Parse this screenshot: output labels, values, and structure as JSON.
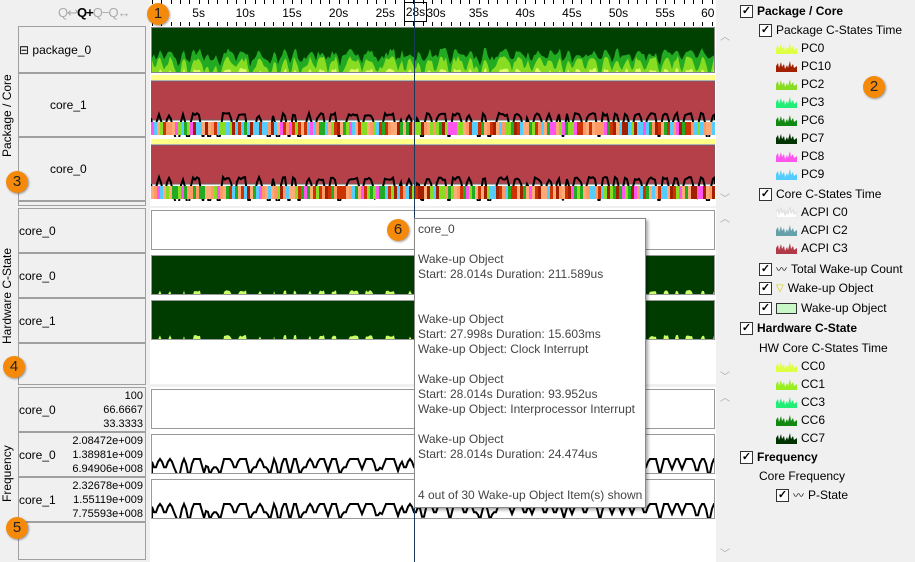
{
  "toolbar": {
    "zoom_icons": [
      "zoom-undo",
      "zoom-in",
      "zoom-out",
      "zoom-fit"
    ]
  },
  "ruler": {
    "labels": [
      "5s",
      "10s",
      "15s",
      "20s",
      "25s",
      "30s",
      "35s",
      "40s",
      "45s",
      "50s",
      "55s",
      "60"
    ],
    "current": "28s"
  },
  "sections": {
    "package_core": {
      "title": "Package / Core",
      "rows": [
        "package_0",
        "core_1",
        "core_0"
      ],
      "expand_symbol": "⊟"
    },
    "hardware": {
      "title": "Hardware C-State",
      "rows": [
        "core_0",
        "core_0",
        "core_1"
      ]
    },
    "frequency": {
      "title": "Frequency",
      "rows": [
        {
          "name": "core_0",
          "scale": [
            "100",
            "66.6667",
            "33.3333"
          ]
        },
        {
          "name": "core_0",
          "scale": [
            "2.08472e+009",
            "1.38981e+009",
            "6.94906e+008"
          ]
        },
        {
          "name": "core_1",
          "scale": [
            "2.32678e+009",
            "1.55119e+009",
            "7.75593e+008"
          ]
        }
      ]
    }
  },
  "legend": {
    "package_core": "Package / Core",
    "pkg_cstates": "Package C-States Time",
    "pkg_items": [
      {
        "label": "PC0",
        "color": "#ddff44"
      },
      {
        "label": "PC10",
        "color": "#a02000"
      },
      {
        "label": "PC2",
        "color": "#88dd22"
      },
      {
        "label": "PC3",
        "color": "#22ee77"
      },
      {
        "label": "PC6",
        "color": "#118811"
      },
      {
        "label": "PC7",
        "color": "#003300"
      },
      {
        "label": "PC8",
        "color": "#ff55ee"
      },
      {
        "label": "PC9",
        "color": "#55ccff"
      }
    ],
    "core_cstates": "Core C-States Time",
    "core_items": [
      {
        "label": "ACPI C0",
        "color": "#ffffff"
      },
      {
        "label": "ACPI C2",
        "color": "#66a0aa"
      },
      {
        "label": "ACPI C3",
        "color": "#b03a48"
      }
    ],
    "total_wakeup": "Total Wake-up Count",
    "wakeup1": "Wake-up Object",
    "wakeup2": "Wake-up Object",
    "hardware": "Hardware C-State",
    "hw_core": "HW Core C-States Time",
    "hw_items": [
      {
        "label": "CC0",
        "color": "#ddff44"
      },
      {
        "label": "CC1",
        "color": "#99ee22"
      },
      {
        "label": "CC3",
        "color": "#22ee77"
      },
      {
        "label": "CC6",
        "color": "#118811"
      },
      {
        "label": "CC7",
        "color": "#003300"
      }
    ],
    "frequency": "Frequency",
    "core_freq": "Core Frequency",
    "pstate": "P-State"
  },
  "tooltip": {
    "title": "core_0",
    "items": [
      {
        "name": "Wake-up Object",
        "detail": "Start: 28.014s Duration: 211.589us",
        "extra": ""
      },
      {
        "name": "Wake-up Object",
        "detail": "Start: 27.998s Duration: 15.603ms",
        "extra": "Wake-up Object: Clock Interrupt"
      },
      {
        "name": "Wake-up Object",
        "detail": "Start: 28.014s Duration: 93.952us",
        "extra": "Wake-up Object: Interprocessor Interrupt"
      },
      {
        "name": "Wake-up Object",
        "detail": "Start: 28.014s Duration: 24.474us",
        "extra": ""
      }
    ],
    "footer": "4 out of 30 Wake-up Object Item(s) shown"
  },
  "badges": [
    "1",
    "2",
    "3",
    "4",
    "5",
    "6"
  ],
  "colors": {
    "core_bg": "#b5404a",
    "hw_bg": "#003c00",
    "spike": "#ccff66",
    "pkg_bg": "#004000"
  }
}
